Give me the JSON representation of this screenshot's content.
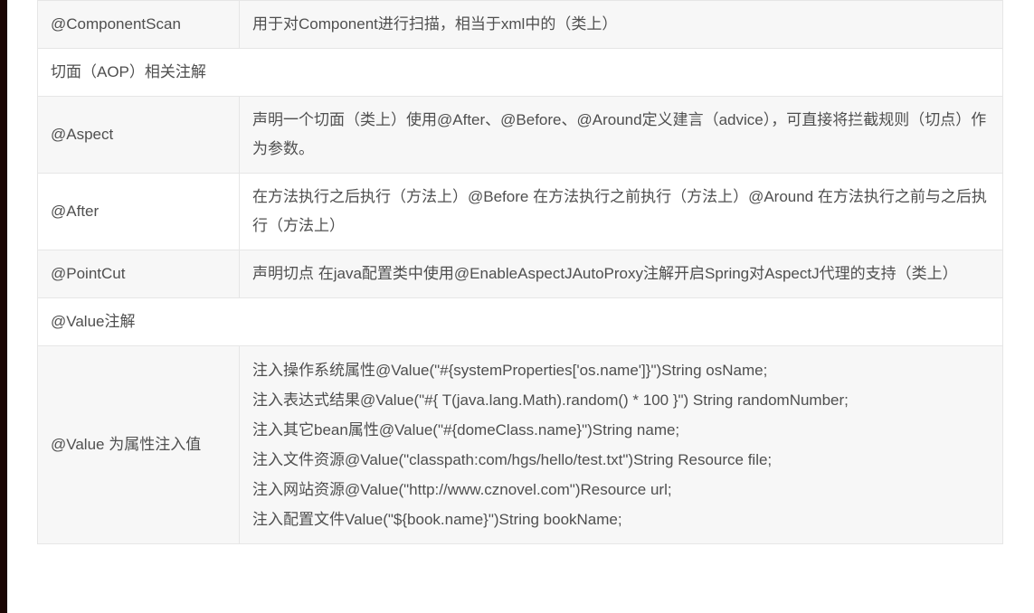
{
  "page": {
    "accent_strip_color": "#1b0604",
    "row_alt_color": "#f7f7f7",
    "row_base_color": "#ffffff",
    "border_color": "#e6e6e6",
    "text_color": "#4f4f4f"
  },
  "table": {
    "spacer_row": {
      "key": "",
      "desc": ""
    },
    "rows": [
      {
        "type": "pair",
        "key": "@ComponentScan",
        "desc": "用于对Component进行扫描，相当于xml中的（类上）"
      },
      {
        "type": "section",
        "title": "切面（AOP）相关注解"
      },
      {
        "type": "pair",
        "key": "@Aspect",
        "desc": "声明一个切面（类上）使用@After、@Before、@Around定义建言（advice），可直接将拦截规则（切点）作为参数。"
      },
      {
        "type": "pair",
        "key": "@After",
        "desc": "在方法执行之后执行（方法上）@Before 在方法执行之前执行（方法上）@Around 在方法执行之前与之后执行（方法上）"
      },
      {
        "type": "pair",
        "key": "@PointCut",
        "desc": "声明切点 在java配置类中使用@EnableAspectJAutoProxy注解开启Spring对AspectJ代理的支持（类上）"
      },
      {
        "type": "section",
        "title": "@Value注解"
      },
      {
        "type": "code",
        "key": "@Value 为属性注入值",
        "lines": [
          "注入操作系统属性@Value(\"#{systemProperties['os.name']}\")String osName;",
          "注入表达式结果@Value(\"#{ T(java.lang.Math).random() * 100 }\") String randomNumber;",
          "注入其它bean属性@Value(\"#{domeClass.name}\")String name;",
          "注入文件资源@Value(\"classpath:com/hgs/hello/test.txt\")String Resource file;",
          "注入网站资源@Value(\"http://www.cznovel.com\")Resource url;",
          "注入配置文件Value(\"${book.name}\")String bookName;"
        ]
      }
    ]
  }
}
